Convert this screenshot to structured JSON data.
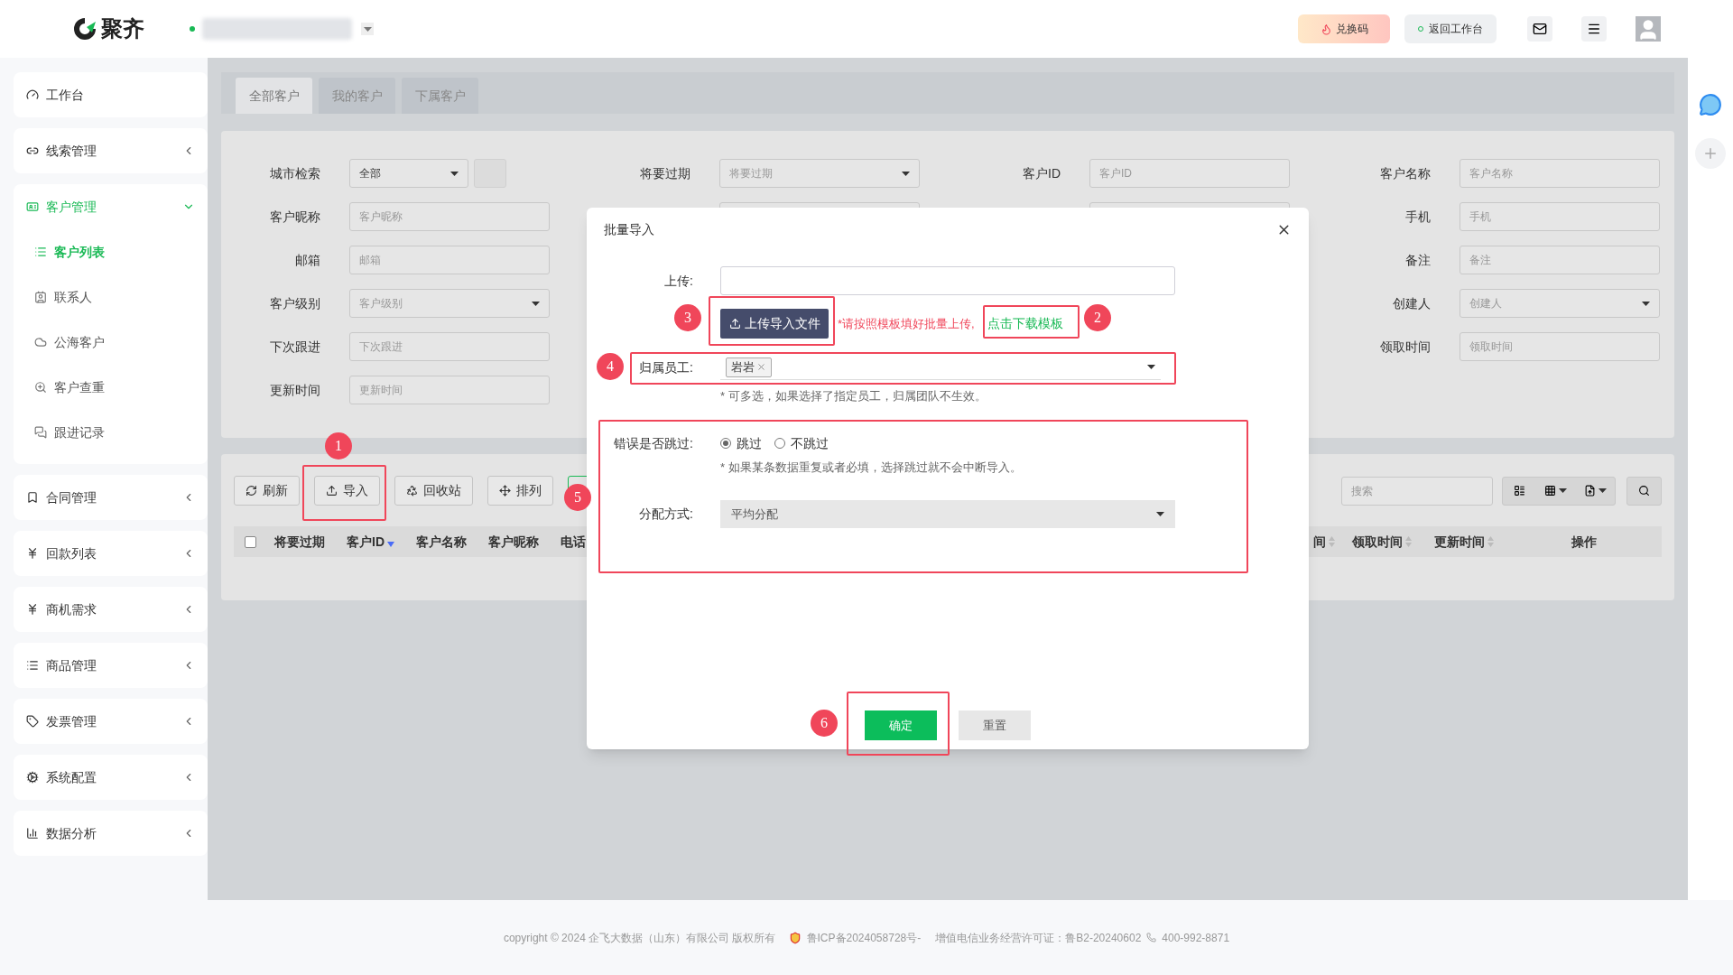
{
  "header": {
    "logo_text": "聚齐",
    "buttons": [
      {
        "label": "兑换码",
        "kind": "redeem"
      },
      {
        "label": "返回工作台",
        "kind": "back"
      }
    ]
  },
  "sidebar": {
    "items": [
      {
        "label": "工作台",
        "selected": false
      },
      {
        "label": "线索管理",
        "selected": false,
        "expanded": false
      },
      {
        "label": "客户管理",
        "selected": true,
        "expanded": true,
        "children": [
          {
            "label": "客户列表",
            "selected": true
          },
          {
            "label": "联系人",
            "selected": false
          },
          {
            "label": "公海客户",
            "selected": false
          },
          {
            "label": "客户查重",
            "selected": false
          },
          {
            "label": "跟进记录",
            "selected": false
          }
        ]
      },
      {
        "label": "合同管理",
        "selected": false,
        "expanded": false
      },
      {
        "label": "回款列表",
        "selected": false,
        "expanded": false
      },
      {
        "label": "商机需求",
        "selected": false,
        "expanded": false
      },
      {
        "label": "商品管理",
        "selected": false,
        "expanded": false
      },
      {
        "label": "发票管理",
        "selected": false,
        "expanded": false
      },
      {
        "label": "系统配置",
        "selected": false,
        "expanded": false
      },
      {
        "label": "数据分析",
        "selected": false,
        "expanded": false
      }
    ]
  },
  "tabs": [
    {
      "label": "全部客户",
      "selected": true
    },
    {
      "label": "我的客户",
      "selected": false
    },
    {
      "label": "下属客户",
      "selected": false
    }
  ],
  "filters": {
    "columns": [
      [
        {
          "label": "城市检索",
          "kind": "select_with_button",
          "value": "全部"
        },
        {
          "label": "客户昵称",
          "kind": "input",
          "placeholder": "客户昵称"
        },
        {
          "label": "邮箱",
          "kind": "input",
          "placeholder": "邮箱"
        },
        {
          "label": "客户级别",
          "kind": "select",
          "placeholder": "客户级别"
        },
        {
          "label": "下次跟进",
          "kind": "input",
          "placeholder": "下次跟进"
        },
        {
          "label": "更新时间",
          "kind": "input",
          "placeholder": "更新时间"
        }
      ],
      [
        {
          "label": "将要过期",
          "kind": "select",
          "placeholder": "将要过期"
        },
        {
          "kind": "covered"
        }
      ],
      [
        {
          "label": "客户ID",
          "kind": "input",
          "placeholder": "客户ID"
        },
        {
          "kind": "covered"
        }
      ],
      [
        {
          "label": "客户名称",
          "kind": "input",
          "placeholder": "客户名称"
        },
        {
          "label": "手机",
          "kind": "input",
          "placeholder": "手机"
        },
        {
          "label": "备注",
          "kind": "input",
          "placeholder": "备注"
        },
        {
          "label": "创建人",
          "kind": "select",
          "placeholder": "创建人"
        },
        {
          "label": "领取时间",
          "kind": "input",
          "placeholder": "领取时间"
        }
      ]
    ]
  },
  "table": {
    "toolbar": [
      {
        "label": "刷新",
        "kind": "refresh"
      },
      {
        "label": "导入",
        "kind": "import"
      },
      {
        "label": "回收站",
        "kind": "recycle"
      },
      {
        "label": "排列",
        "kind": "arrange"
      },
      {
        "kind": "covered"
      }
    ],
    "search": {
      "placeholder": "搜索"
    },
    "select_all": {
      "checked": false
    },
    "columns_left": [
      {
        "label": "将要过期"
      },
      {
        "label": "客户ID",
        "sorted": true
      },
      {
        "label": "客户名称"
      },
      {
        "label": "客户昵称"
      },
      {
        "label": "电话"
      }
    ],
    "columns_right": [
      {
        "label": "间",
        "sorted": false
      },
      {
        "label": "领取时间",
        "sorted": false
      },
      {
        "label": "更新时间",
        "sorted": false
      },
      {
        "label": "操作"
      }
    ]
  },
  "modal": {
    "title": "批量导入",
    "upload_label": "上传:",
    "upload_button": "上传导入文件",
    "upload_hint": "*请按照模板填好批量上传,",
    "template_link": "点击下载模板",
    "employee_label": "归属员工:",
    "employee_tags": [
      "岩岩"
    ],
    "employee_hint": "* 可多选，如果选择了指定员工，归属团队不生效。",
    "skip_label": "错误是否跳过:",
    "skip_options": [
      {
        "label": "跳过",
        "selected": true
      },
      {
        "label": "不跳过",
        "selected": false
      }
    ],
    "skip_hint": "* 如果某条数据重复或者必填，选择跳过就不会中断导入。",
    "assign_label": "分配方式:",
    "assign_value": "平均分配",
    "buttons": [
      {
        "label": "确定",
        "kind": "primary"
      },
      {
        "label": "重置",
        "kind": "secondary"
      }
    ]
  },
  "annotations": [
    "1",
    "5",
    "3",
    "2",
    "4",
    "6"
  ],
  "footer": {
    "copyright": "copyright © 2024 企飞大数据（山东）有限公司 版权所有",
    "icp": "鲁ICP备2024058728号-",
    "license": "增值电信业务经营许可证：鲁B2-20240602",
    "phone": "400-992-8871"
  }
}
